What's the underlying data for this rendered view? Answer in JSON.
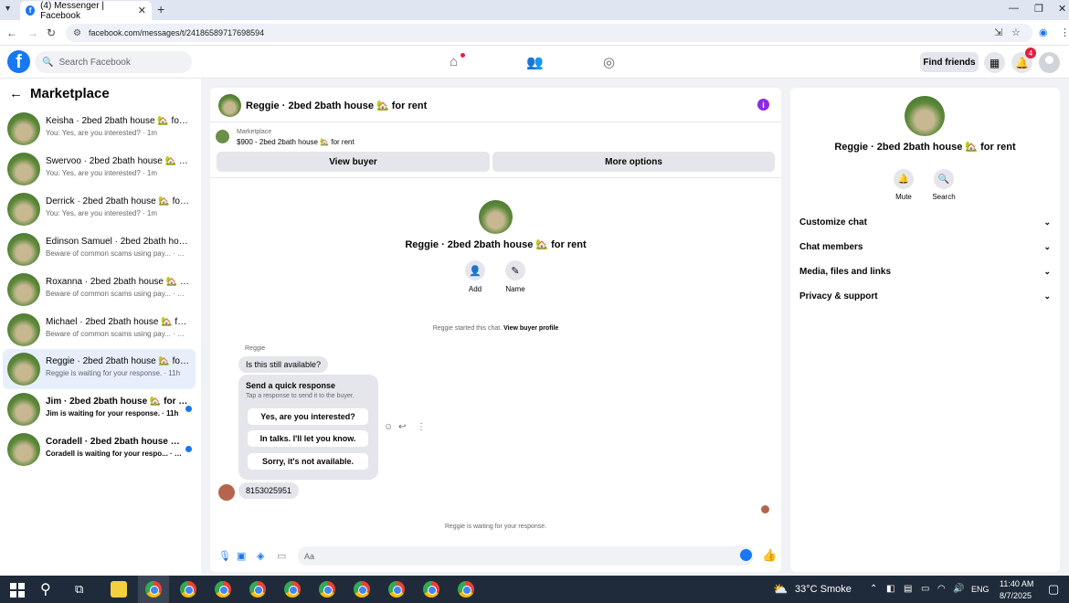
{
  "browser": {
    "tab_title": "(4) Messenger | Facebook",
    "url": "facebook.com/messages/t/24186589717698594"
  },
  "fb": {
    "search_placeholder": "Search Facebook",
    "find_friends": "Find friends",
    "notification_count": "4"
  },
  "sidebar": {
    "title": "Marketplace",
    "conversations": [
      {
        "title": "Keisha · 2bed 2bath house 🏡 for r...",
        "sub": "You: Yes, are you interested? · 1m"
      },
      {
        "title": "Swervoo · 2bed 2bath house 🏡 fo...",
        "sub": "You: Yes, are you interested? · 1m"
      },
      {
        "title": "Derrick · 2bed 2bath house 🏡 for ...",
        "sub": "You: Yes, are you interested? · 1m"
      },
      {
        "title": "Edinson Samuel · 2bed 2bath hous...",
        "sub": "Beware of common scams using pay... · 1m"
      },
      {
        "title": "Roxanna · 2bed 2bath house 🏡 fo...",
        "sub": "Beware of common scams using pay... · 1m"
      },
      {
        "title": "Michael · 2bed 2bath house 🏡 for...",
        "sub": "Beware of common scams using pay... · 1m"
      },
      {
        "title": "Reggie · 2bed 2bath house 🏡 for ...",
        "sub": "Reggie is waiting for your response. · 11h"
      },
      {
        "title": "Jim · 2bed 2bath house 🏡 for rent",
        "sub": "Jim is waiting for your response. · 11h"
      },
      {
        "title": "Coradell · 2bed 2bath house 🏡 f...",
        "sub": "Coradell is waiting for your respo... · 11h"
      }
    ]
  },
  "chat": {
    "header_title": "Reggie · 2bed 2bath house 🏡 for rent",
    "marketplace_label": "Marketplace",
    "listing": "$900 - 2bed 2bath house 🏡 for rent",
    "view_buyer": "View buyer",
    "more_options": "More options",
    "center_title": "Reggie · 2bed 2bath house 🏡 for rent",
    "add_label": "Add",
    "name_label": "Name",
    "started_text": "Reggie started this chat.",
    "view_buyer_profile": "View buyer profile",
    "sender_name": "Reggie",
    "first_message": "Is this still available?",
    "quick_response_title": "Send a quick response",
    "quick_response_sub": "Tap a response to send it to the buyer.",
    "quick_options": [
      "Yes, are you interested?",
      "In talks. I'll let you know.",
      "Sorry, it's not available."
    ],
    "phone_message": "8153025951",
    "waiting_text": "Reggie is waiting for your response.",
    "compose_placeholder": "Aa"
  },
  "right_panel": {
    "title": "Reggie · 2bed 2bath house 🏡 for rent",
    "mute": "Mute",
    "search": "Search",
    "sections": [
      "Customize chat",
      "Chat members",
      "Media, files and links",
      "Privacy & support"
    ]
  },
  "taskbar": {
    "weather": "33°C  Smoke",
    "lang": "ENG",
    "time": "11:40 AM",
    "date": "8/7/2025"
  }
}
